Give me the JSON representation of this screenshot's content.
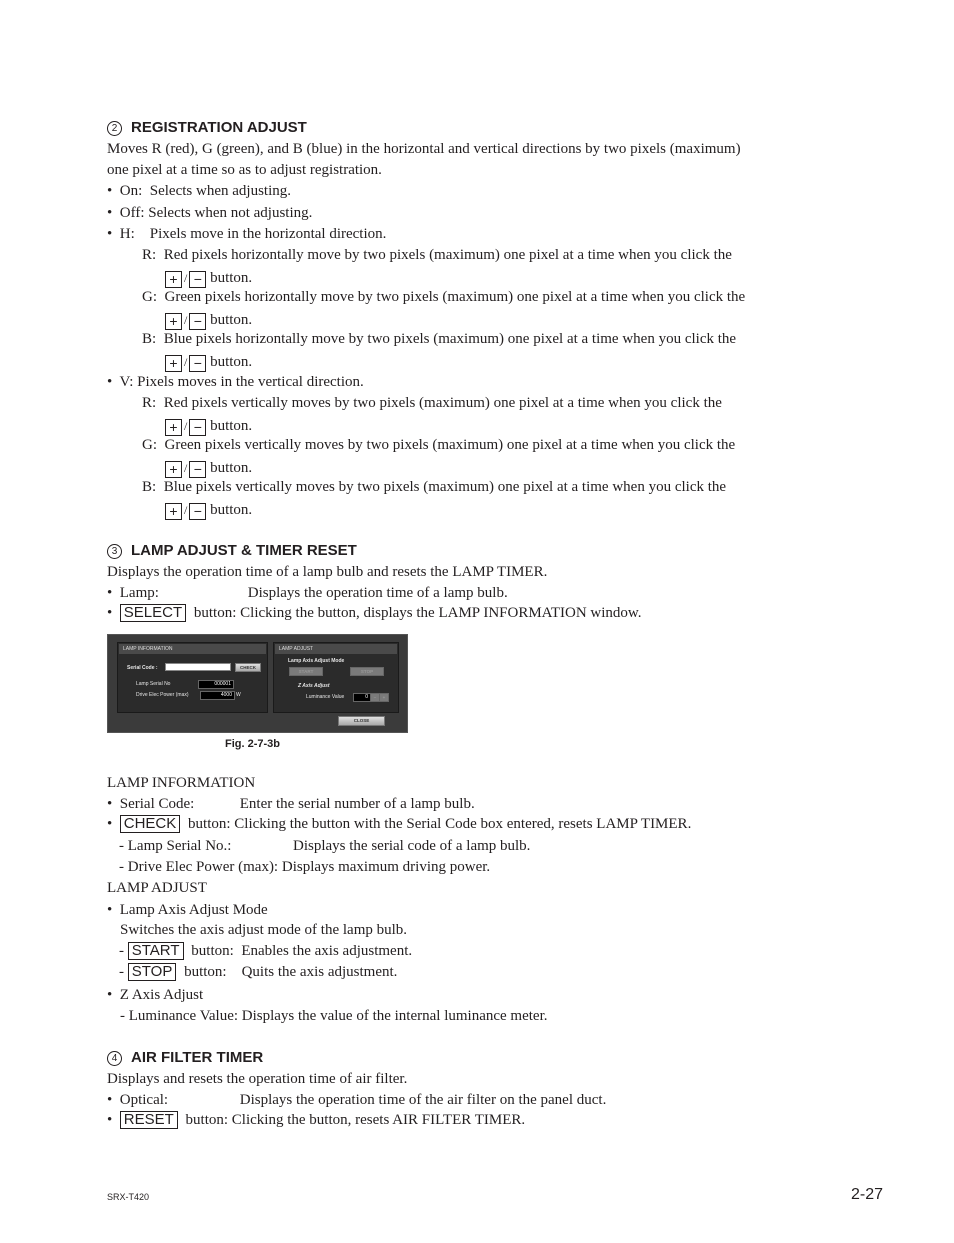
{
  "section2": {
    "number": "2",
    "title": "REGISTRATION ADJUST",
    "intro_line1": "Moves R (red), G (green), and B (blue) in the horizontal and vertical directions by two pixels (maximum)",
    "intro_line2": "one pixel at a time so as to adjust registration.",
    "on": {
      "bullet": "•",
      "label": "On:",
      "desc": "Selects when adjusting."
    },
    "off": {
      "bullet": "•",
      "label": "Off:",
      "desc": "Selects when not adjusting."
    },
    "h": {
      "bullet": "•",
      "label": "H:",
      "desc": "Pixels move in the horizontal direction.",
      "items": [
        {
          "label": "R:",
          "desc": "Red pixels horizontally move by two pixels (maximum) one pixel at a time when you click the"
        },
        {
          "label": "G:",
          "desc": "Green pixels horizontally move by two pixels (maximum) one pixel at a time when you click the"
        },
        {
          "label": "B:",
          "desc": "Blue pixels horizontally move by two pixels (maximum) one pixel at a time when you click the"
        }
      ]
    },
    "v": {
      "bullet": "•",
      "label": "V:",
      "desc": "Pixels moves in the vertical direction.",
      "items": [
        {
          "label": "R:",
          "desc": "Red pixels vertically moves by two pixels (maximum) one pixel at a time when you click the"
        },
        {
          "label": "G:",
          "desc": "Green pixels vertically moves by two pixels (maximum) one pixel at a time when you click the"
        },
        {
          "label": "B:",
          "desc": "Blue pixels vertically moves by two pixels (maximum) one pixel at a time when you click the"
        }
      ]
    },
    "plus": "+",
    "slash": "/",
    "minus": "−",
    "button_word": "button."
  },
  "section3": {
    "number": "3",
    "title": "LAMP ADJUST & TIMER RESET",
    "intro": "Displays the operation time of a lamp bulb and resets the LAMP TIMER.",
    "lamp": {
      "bullet": "•",
      "label": "Lamp:",
      "desc": "Displays the operation time of a lamp bulb."
    },
    "select": {
      "bullet": "•",
      "button": "SELECT",
      "suffix": "button:",
      "desc": "Clicking the button, displays the LAMP INFORMATION window."
    },
    "figure": {
      "caption": "Fig. 2-7-3b",
      "lamp_info": {
        "title": "LAMP INFORMATION",
        "serial_code_label": "Serial Code :",
        "serial_code_value": "",
        "check_button": "CHECK",
        "lamp_serial_label": "Lamp Serial No",
        "lamp_serial_value": "000001",
        "drive_power_label": "Drive Elec Power (max)",
        "drive_power_value": "4000",
        "drive_power_unit": "W"
      },
      "lamp_adjust": {
        "title": "LAMP ADJUST",
        "axis_mode_label": "Lamp Axis Adjust Mode",
        "start_button": "START",
        "stop_button": "STOP",
        "z_axis_label": "Z Axis Adjust",
        "luminance_label": "Luminance Value",
        "luminance_value": "0",
        "minus": "−",
        "plus": "+"
      },
      "close_button": "CLOSE"
    },
    "lamp_information": {
      "heading": "LAMP INFORMATION",
      "serial": {
        "bullet": "•",
        "label": "Serial Code:",
        "desc": "Enter the serial number of a lamp bulb."
      },
      "check": {
        "bullet": "•",
        "button": "CHECK",
        "suffix": "button:",
        "desc": "Clicking the button with the Serial Code box entered, resets LAMP TIMER."
      },
      "serial_no": {
        "label": "- Lamp Serial No.:",
        "desc": "Displays the serial code of a lamp bulb."
      },
      "drive": {
        "label": "- Drive Elec Power (max):",
        "desc": "Displays maximum driving power."
      }
    },
    "lamp_adjust": {
      "heading": "LAMP ADJUST",
      "axis_mode": {
        "bullet": "•",
        "label": "Lamp Axis Adjust Mode",
        "desc": "Switches the axis adjust mode of the lamp bulb."
      },
      "start": {
        "dash": "-",
        "button": "START",
        "suffix": "button:",
        "desc": "Enables the axis adjustment."
      },
      "stop": {
        "dash": "-",
        "button": "STOP",
        "suffix": "button:",
        "desc": "Quits the axis adjustment."
      },
      "z_axis": {
        "bullet": "•",
        "label": "Z Axis Adjust"
      },
      "luminance": {
        "label": "- Luminance Value:",
        "desc": "Displays the value of the internal luminance meter."
      }
    }
  },
  "section4": {
    "number": "4",
    "title": "AIR FILTER TIMER",
    "intro": "Displays and resets the operation time of air filter.",
    "optical": {
      "bullet": "•",
      "label": "Optical:",
      "desc": "Displays the operation time of the air filter on the panel duct."
    },
    "reset": {
      "bullet": "•",
      "button": "RESET",
      "suffix": "button:",
      "desc": "Clicking the button, resets AIR FILTER TIMER."
    }
  },
  "footer": {
    "model": "SRX-T420",
    "page": "2-27"
  }
}
